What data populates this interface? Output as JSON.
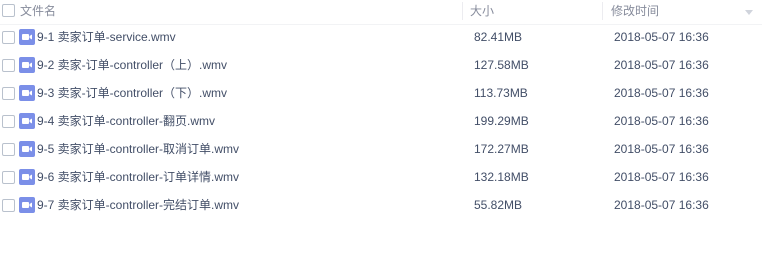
{
  "header": {
    "name_label": "文件名",
    "size_label": "大小",
    "modified_label": "修改时间"
  },
  "files": [
    {
      "name": "9-1 卖家订单-service.wmv",
      "size": "82.41MB",
      "modified": "2018-05-07 16:36",
      "icon": "video-file-icon"
    },
    {
      "name": "9-2 卖家-订单-controller（上）.wmv",
      "size": "127.58MB",
      "modified": "2018-05-07 16:36",
      "icon": "video-file-icon"
    },
    {
      "name": "9-3 卖家-订单-controller（下）.wmv",
      "size": "113.73MB",
      "modified": "2018-05-07 16:36",
      "icon": "video-file-icon"
    },
    {
      "name": "9-4 卖家订单-controller-翻页.wmv",
      "size": "199.29MB",
      "modified": "2018-05-07 16:36",
      "icon": "video-file-icon"
    },
    {
      "name": "9-5 卖家订单-controller-取消订单.wmv",
      "size": "172.27MB",
      "modified": "2018-05-07 16:36",
      "icon": "video-file-icon"
    },
    {
      "name": "9-6 卖家订单-controller-订单详情.wmv",
      "size": "132.18MB",
      "modified": "2018-05-07 16:36",
      "icon": "video-file-icon"
    },
    {
      "name": "9-7 卖家订单-controller-完结订单.wmv",
      "size": "55.82MB",
      "modified": "2018-05-07 16:36",
      "icon": "video-file-icon"
    }
  ],
  "colors": {
    "text": "#424e67",
    "header_text": "#878c9c",
    "video_icon": "#7b8fe8",
    "checkbox_border": "#b9c1cd"
  }
}
